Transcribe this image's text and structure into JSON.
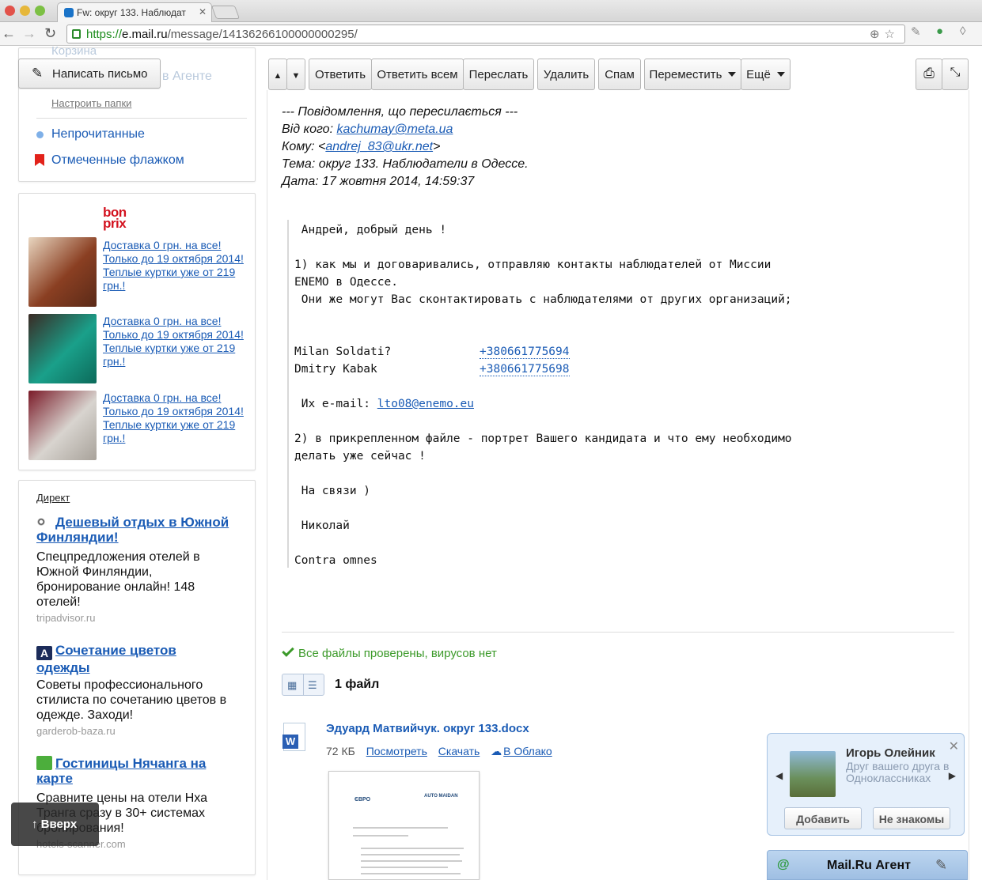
{
  "browser": {
    "tab_title": "Fw: округ 133. Наблюдат",
    "url_scheme": "https://",
    "url_host": "e.mail.ru",
    "url_path": "/message/14136266100000000295/"
  },
  "sidebar": {
    "ghost_trash": "Корзина",
    "ghost_agent": "в Агенте",
    "compose_label": "Написать письмо",
    "configure_folders": "Настроить папки",
    "unread": "Непрочитанные",
    "flagged": "Отмеченные флажком"
  },
  "ad_bonprix": {
    "logo": "bon prix",
    "items": [
      {
        "text": "Доставка 0 грн. на все! Только до 19 октября 2014! Теплые куртки уже от 219 грн.!",
        "image": "woman-brown-jacket"
      },
      {
        "text": "Доставка 0 грн. на все! Только до 19 октября 2014! Теплые куртки уже от 219 грн.!",
        "image": "woman-teal-jacket"
      },
      {
        "text": "Доставка 0 грн. на все! Только до 19 октября 2014! Теплые куртки уже от 219 грн.!",
        "image": "woman-fur-jacket"
      }
    ]
  },
  "direkt": {
    "label": "Директ",
    "items": [
      {
        "title": "Дешевый отдых в Южной Финляндии!",
        "body": "Спецпредложения отелей в Южной Финляндии, бронирование онлайн! 148 отелей!",
        "source": "tripadvisor.ru",
        "icon": "owl-icon"
      },
      {
        "title": "Сочетание цветов одежды",
        "body": "Советы профессионального стилиста по сочетанию цветов в одежде. Заходи!",
        "source": "garderob-baza.ru",
        "icon": "font-a-icon"
      },
      {
        "title": "Гостиницы Нячанга на карте",
        "body": "Сравните цены на отели Нха Транга сразу в 30+ системах бронирования!",
        "source": "hotels-scanner.com",
        "icon": "house-icon"
      }
    ]
  },
  "scroll_up": {
    "arrow": "↑",
    "label": "Вверх"
  },
  "toolbar": {
    "up": "▲",
    "down": "▼",
    "reply": "Ответить",
    "reply_all": "Ответить всем",
    "forward": "Переслать",
    "delete": "Удалить",
    "spam": "Спам",
    "move": "Переместить",
    "more": "Ещё"
  },
  "message": {
    "fwd_header": "--- Повідомлення, що пересилається ---",
    "from_label": "Від кого: ",
    "from_email": "kachumay@meta.ua",
    "to_label": "Кому: <",
    "to_email": "andrej_83@ukr.net",
    "to_close": ">",
    "subject": "Тема: округ 133. Наблюдатели в Одессе.",
    "date": "Дата: 17 жовтня 2014, 14:59:37",
    "greeting": " Андрей, добрый день !",
    "p1_line1": "1) как мы и договаривались, отправляю контакты наблюдателей от Миссии",
    "p1_line2": "ENEMO в Одессе.",
    "p1_line3": " Они же могут Вас сконтактировать с наблюдателями от других организаций;",
    "contacts": [
      {
        "name": "Milan Soldati?",
        "phone": "+380661775694"
      },
      {
        "name": "Dmitry Kabak",
        "phone": "+380661775698"
      }
    ],
    "email_label": " Их e-mail: ",
    "email_value": "lto08@enemo.eu",
    "p2_line1": "2) в прикрепленном файле - портрет Вашего кандидата и что ему необходимо",
    "p2_line2": "делать уже сейчас !",
    "bye": " На связи )",
    "signature_name": " Николай",
    "motto": "Contra omnes"
  },
  "attachments": {
    "virus_status": "Все файлы проверены, вирусов нет",
    "count_label": "1 файл",
    "file_name": "Эдуард Матвийчук. округ 133.docx",
    "file_size": "72 КБ",
    "view": "Посмотреть",
    "download": "Скачать",
    "cloud": "В Облако",
    "thumb_logo_left": "ЄВРО",
    "thumb_logo_right": "AUTO MAIDAN"
  },
  "social_popup": {
    "name": "Игорь Олейник",
    "subtitle": "Друг вашего друга в Одноклассниках",
    "add": "Добавить",
    "not_known": "Не знакомы",
    "close": "✕"
  },
  "agent": {
    "label": "Mail.Ru Агент"
  },
  "colors": {
    "link": "#1a5bb5",
    "virus_ok": "#3c9a2a",
    "flag": "#e2221a"
  }
}
